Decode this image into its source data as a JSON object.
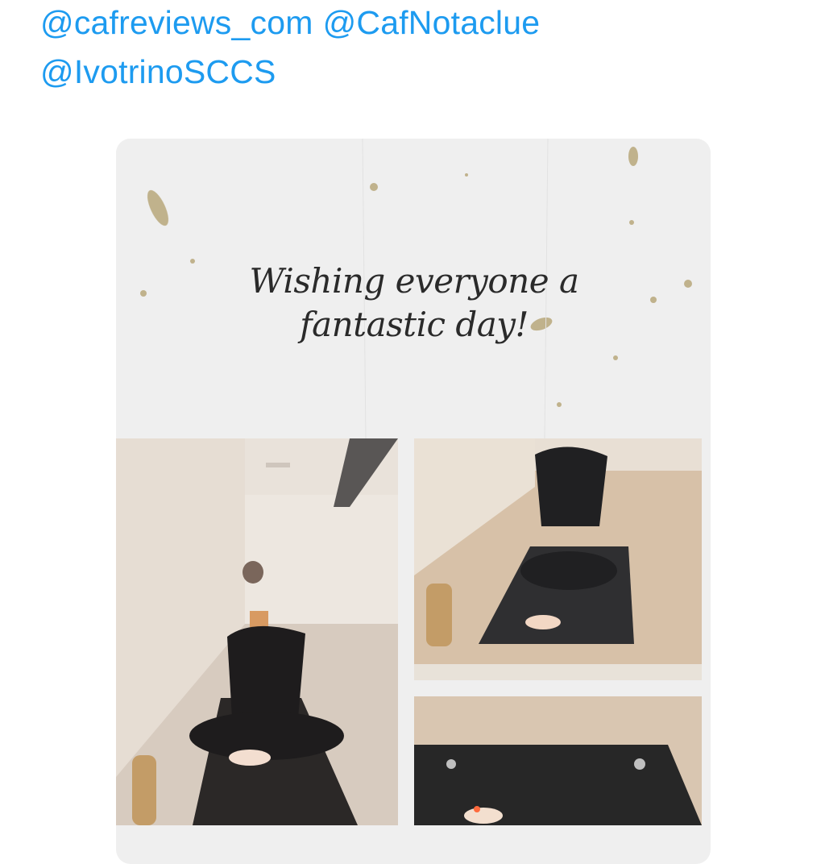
{
  "tweet": {
    "mentions": [
      "@cafreviews_com",
      "@CafNotaclue",
      "@IvotrinoSCCS"
    ]
  },
  "media": {
    "caption_line1": "Wishing everyone a",
    "caption_line2": "fantastic day!",
    "photos": [
      "yoga-photo-seated-mirror-selfie",
      "yoga-photo-crosslegged-mat",
      "yoga-photo-mat-closeup"
    ]
  },
  "colors": {
    "mention": "#1d9bf0",
    "paper": "#efefef",
    "caption": "#2a2a2a"
  }
}
